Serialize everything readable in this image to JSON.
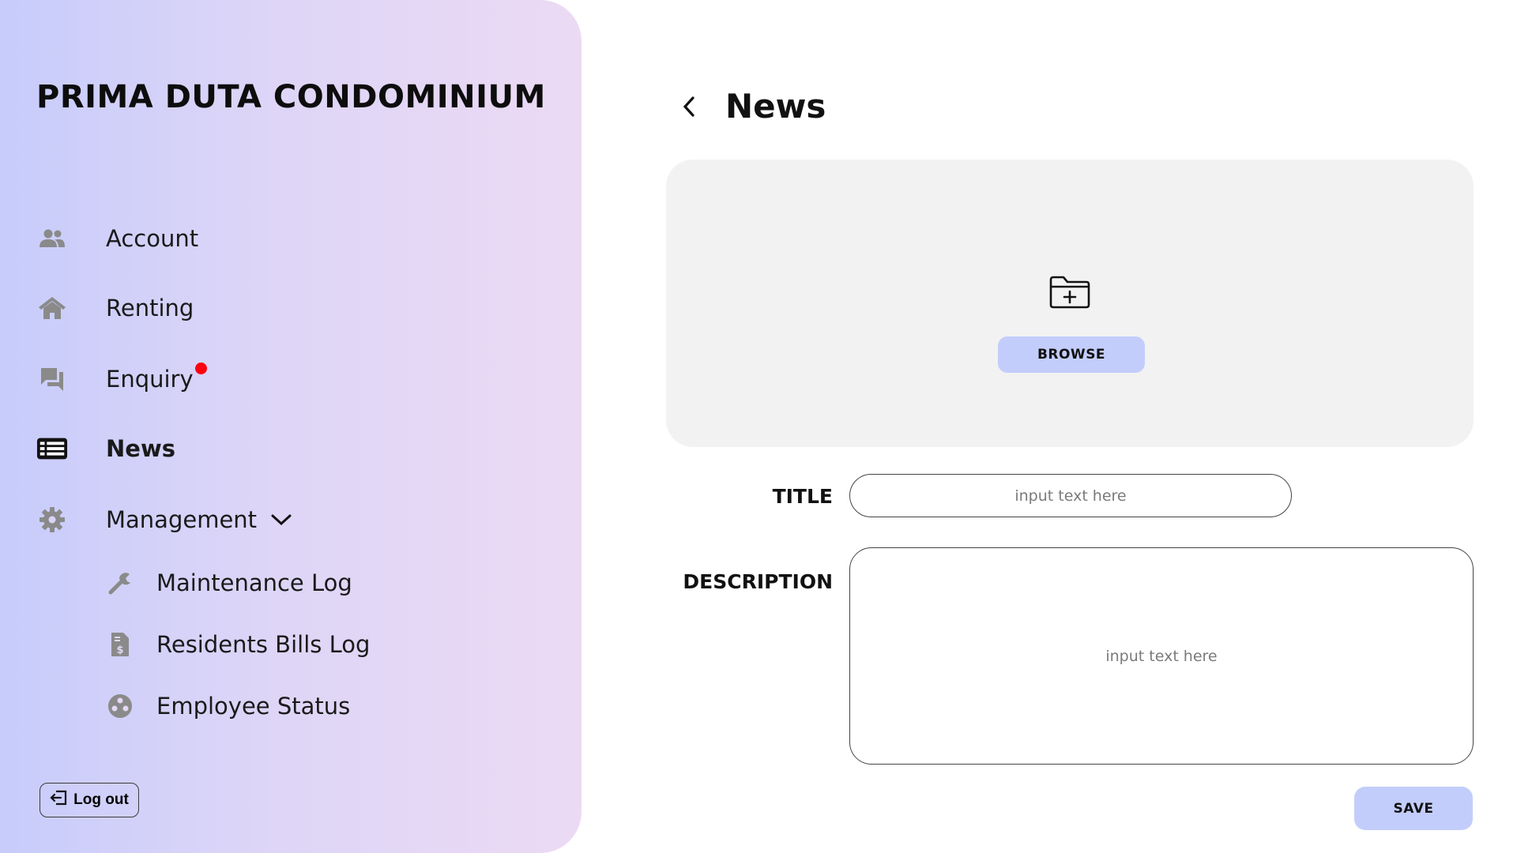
{
  "sidebar": {
    "brand": "PRIMA DUTA CONDOMINIUM",
    "items": [
      {
        "label": "Account",
        "icon": "people-icon"
      },
      {
        "label": "Renting",
        "icon": "home-icon"
      },
      {
        "label": "Enquiry",
        "icon": "chat-icon",
        "has_notification": true
      },
      {
        "label": "News",
        "icon": "newspaper-icon",
        "active": true
      },
      {
        "label": "Management",
        "icon": "gear-icon",
        "expanded": true
      }
    ],
    "sub_items": [
      {
        "label": "Maintenance Log",
        "icon": "wrench-icon"
      },
      {
        "label": "Residents Bills Log",
        "icon": "bill-icon"
      },
      {
        "label": "Employee Status",
        "icon": "employee-icon"
      }
    ],
    "logout_label": "Log out"
  },
  "main": {
    "title": "News",
    "upload": {
      "browse_label": "BROWSE"
    },
    "form": {
      "title_label": "TITLE",
      "title_placeholder": "input text here",
      "description_label": "DESCRIPTION",
      "description_placeholder": "input text here"
    },
    "save_label": "SAVE"
  },
  "colors": {
    "sidebar_gradient_start": "#c7ccfb",
    "sidebar_gradient_end": "#ecdaf4",
    "button_bg": "#c3cdfb",
    "upload_bg": "#f2f2f2",
    "notification_dot": "#ff0010",
    "icon_gray": "#8a8a8a"
  }
}
